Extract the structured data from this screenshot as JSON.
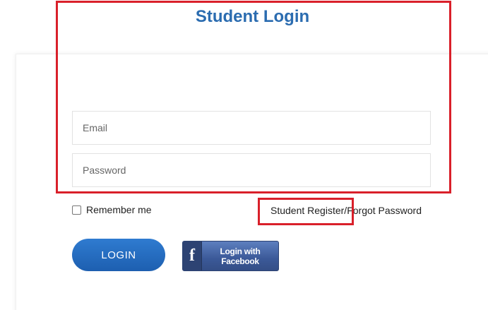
{
  "page": {
    "title": "Student Login"
  },
  "form": {
    "email": {
      "placeholder": "Email",
      "value": ""
    },
    "password": {
      "placeholder": "Password",
      "value": ""
    },
    "remember_label": "Remember me",
    "remember_checked": false,
    "register_link": "Student Register",
    "separator": "/",
    "forgot_link": "Forgot Password",
    "login_label": "LOGIN",
    "facebook_icon": "f",
    "facebook_label": "Login with Facebook"
  },
  "colors": {
    "title": "#2b6cb0",
    "login_button": "#1d5fb0",
    "facebook": "#3b5998",
    "highlight_box": "#d9202a"
  },
  "icons": {
    "facebook": "facebook-icon"
  }
}
